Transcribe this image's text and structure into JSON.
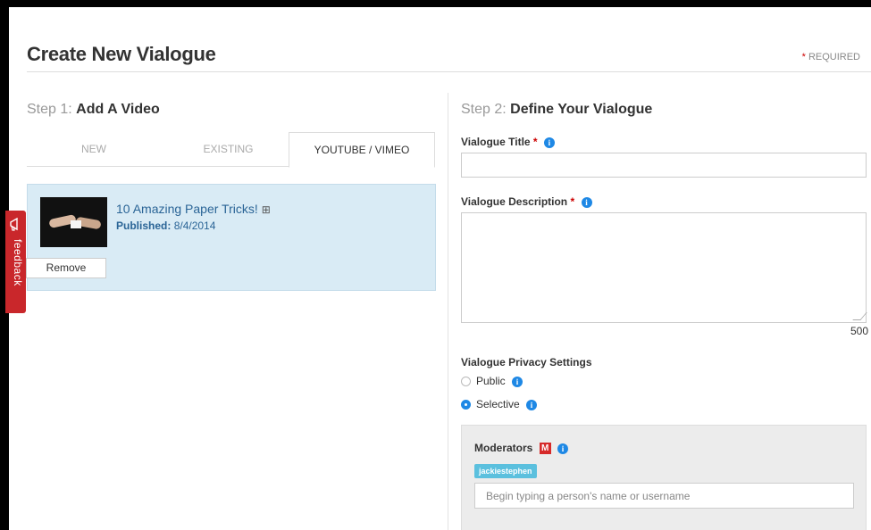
{
  "page": {
    "title": "Create New Vialogue",
    "required_star": "*",
    "required_label": "REQUIRED"
  },
  "step1": {
    "prefix": "Step 1:",
    "title": "Add A Video",
    "tabs": [
      {
        "label": "NEW",
        "active": false
      },
      {
        "label": "EXISTING",
        "active": false
      },
      {
        "label": "YOUTUBE / VIMEO",
        "active": true
      }
    ],
    "video": {
      "title": "10 Amazing Paper Tricks!",
      "expand_icon": "⊞",
      "published_label": "Published:",
      "published_date": "8/4/2014",
      "remove_label": "Remove"
    }
  },
  "feedback": {
    "label": "feedback",
    "icon": "megaphone-icon",
    "color": "#c9272b"
  },
  "step2": {
    "prefix": "Step 2:",
    "title": "Define Your Vialogue",
    "title_field": {
      "label": "Vialogue Title",
      "required": "*",
      "value": ""
    },
    "description_field": {
      "label": "Vialogue Description",
      "required": "*",
      "value": "",
      "char_remaining": "500"
    },
    "privacy": {
      "label": "Vialogue Privacy Settings",
      "options": [
        {
          "label": "Public",
          "selected": false
        },
        {
          "label": "Selective",
          "selected": true
        }
      ]
    },
    "moderators": {
      "label": "Moderators",
      "badge": "M",
      "tags": [
        "jackiestephen"
      ],
      "input_placeholder": "Begin typing a person's name or username"
    }
  },
  "colors": {
    "accent": "#1e88e5",
    "video_card_bg": "#d9ebf5",
    "tag_bg": "#5bc0de",
    "badge_red": "#d62a2a"
  }
}
